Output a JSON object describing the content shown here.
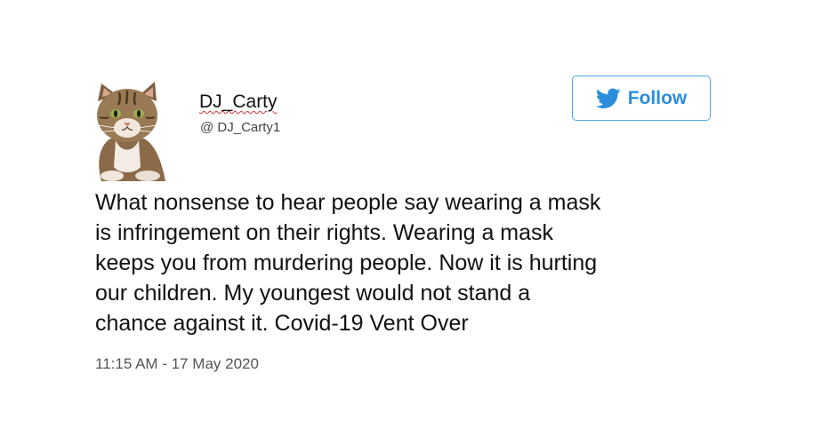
{
  "tweet": {
    "display_name": "DJ_Carty",
    "handle": "@ DJ_Carty1",
    "follow_label": "Follow",
    "text": "What nonsense to hear people say wearing a mask\nis infringement on their rights.  Wearing a mask\nkeeps you from murdering people.  Now it is hurting\nour children.  My youngest would not stand a\nchance against it.  Covid-19 Vent Over",
    "timestamp": "11:15 AM - 17 May 2020"
  },
  "icons": {
    "avatar": "tabby-cat-photo",
    "follow": "twitter-bird-icon"
  },
  "colors": {
    "twitter_blue": "#2b8ddb",
    "button_border": "#4ea6e6",
    "spellcheck_underline": "#d0333a"
  }
}
